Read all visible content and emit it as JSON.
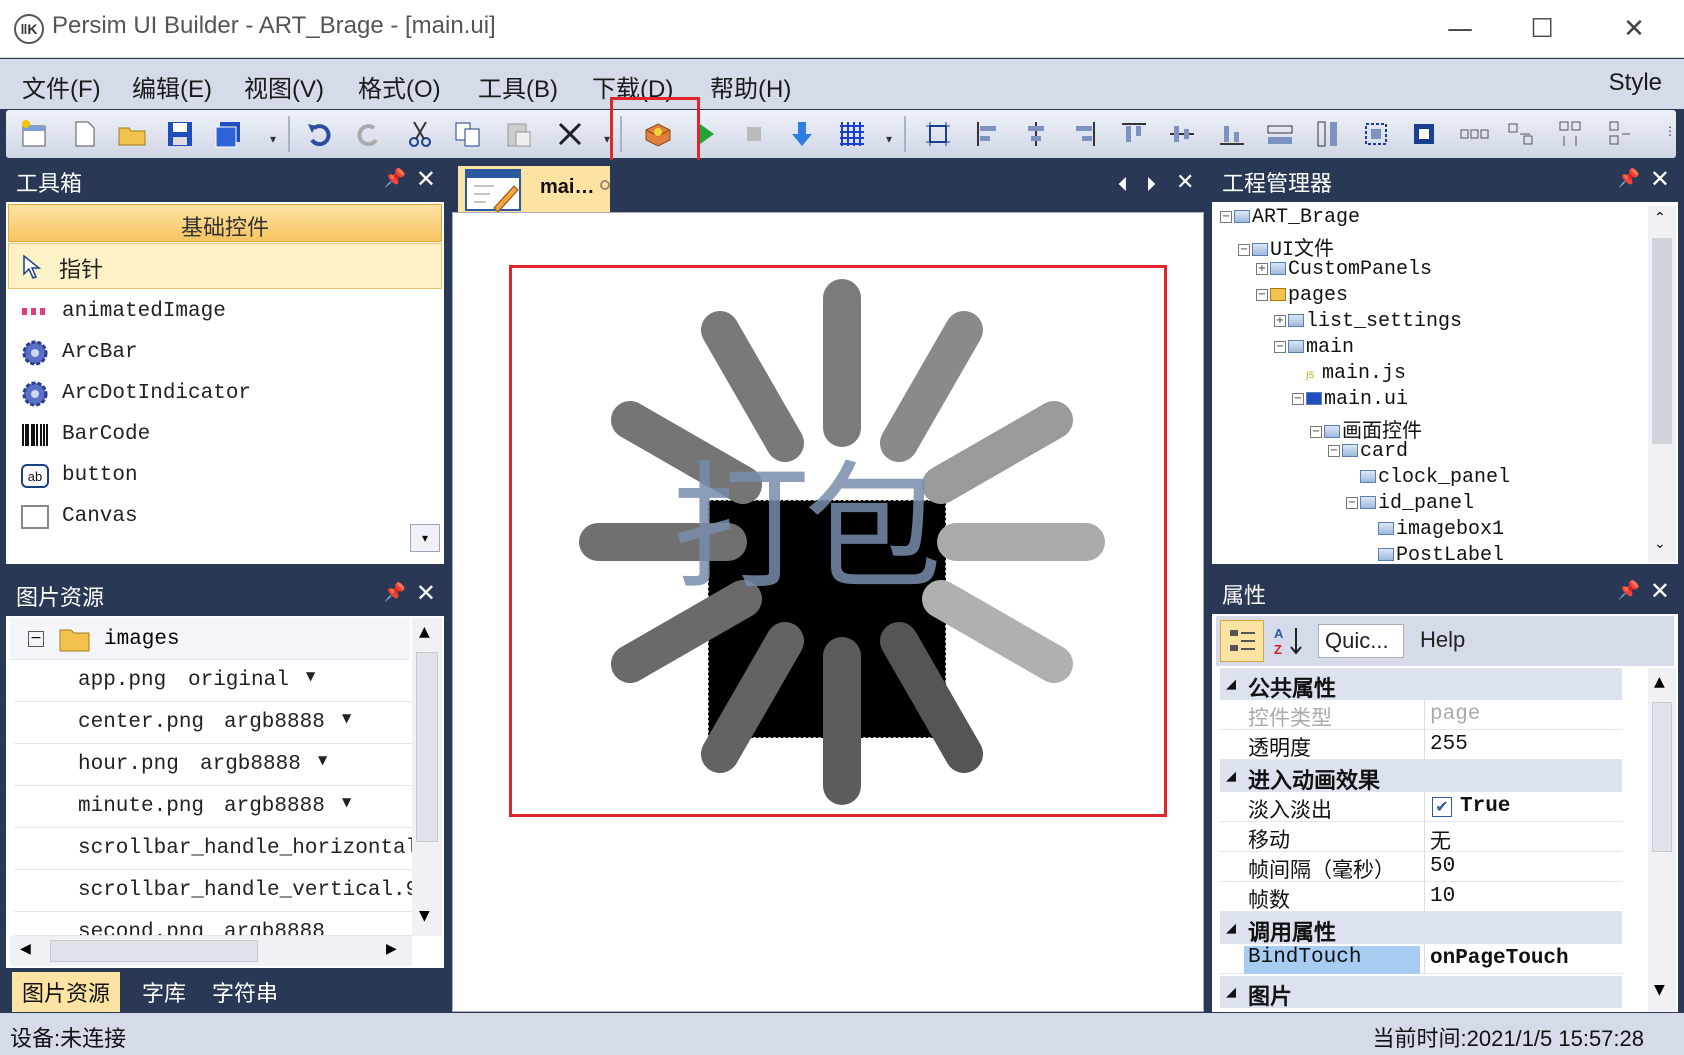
{
  "window": {
    "title": "Persim UI Builder - ART_Brage - [main.ui]",
    "logo_text": "ǁK",
    "minimize": "—",
    "maximize": "☐",
    "close": "✕"
  },
  "menu": {
    "items": [
      "文件(F)",
      "编辑(E)",
      "视图(V)",
      "格式(O)",
      "工具(B)",
      "下载(D)",
      "帮助(H)"
    ],
    "style_label": "Style"
  },
  "toolbox": {
    "title": "工具箱",
    "category": "基础控件",
    "pointer_label": "指针",
    "items": [
      "animatedImage",
      "ArcBar",
      "ArcDotIndicator",
      "BarCode",
      "button",
      "Canvas"
    ],
    "button_icon_text": "ab"
  },
  "images_panel": {
    "title": "图片资源",
    "folder": "images",
    "rows": [
      {
        "name": "app.png",
        "format": "original"
      },
      {
        "name": "center.png",
        "format": "argb8888"
      },
      {
        "name": "hour.png",
        "format": "argb8888"
      },
      {
        "name": "minute.png",
        "format": "argb8888"
      },
      {
        "name": "scrollbar_handle_horizontal.",
        "format": ""
      },
      {
        "name": "scrollbar_handle_vertical.9.",
        "format": ""
      },
      {
        "name": "second.png",
        "format": "argb8888"
      }
    ],
    "tabs": [
      "图片资源",
      "字库",
      "字符串"
    ]
  },
  "editor": {
    "tab_label": "mai…",
    "canvas_text": "打包"
  },
  "project": {
    "title": "工程管理器",
    "tree": [
      {
        "label": "ART_Brage",
        "level": 0,
        "exp": "-"
      },
      {
        "label": "UI文件",
        "level": 1,
        "exp": "-"
      },
      {
        "label": "CustomPanels",
        "level": 2,
        "exp": "+"
      },
      {
        "label": "pages",
        "level": 2,
        "exp": "-"
      },
      {
        "label": "list_settings",
        "level": 3,
        "exp": "+"
      },
      {
        "label": "main",
        "level": 3,
        "exp": "-"
      },
      {
        "label": "main.js",
        "level": 4,
        "exp": ""
      },
      {
        "label": "main.ui",
        "level": 4,
        "exp": "-"
      },
      {
        "label": "画面控件",
        "level": 5,
        "exp": "-"
      },
      {
        "label": "card",
        "level": 6,
        "exp": "-"
      },
      {
        "label": "clock_panel",
        "level": 7,
        "exp": ""
      },
      {
        "label": "id_panel",
        "level": 7,
        "exp": "-"
      },
      {
        "label": "imagebox1",
        "level": 8,
        "exp": ""
      },
      {
        "label": "PostLabel",
        "level": 8,
        "exp": ""
      }
    ]
  },
  "properties": {
    "title": "属性",
    "quick_label": "Quic...",
    "help_label": "Help",
    "categories": [
      {
        "name": "公共属性",
        "rows": [
          {
            "key": "控件类型",
            "value": "page",
            "disabled": true
          },
          {
            "key": "透明度",
            "value": "255"
          }
        ]
      },
      {
        "name": "进入动画效果",
        "rows": [
          {
            "key": "淡入淡出",
            "value": "True",
            "checkbox": true
          },
          {
            "key": "移动",
            "value": "无"
          },
          {
            "key": "帧间隔（毫秒）",
            "value": "50"
          },
          {
            "key": "帧数",
            "value": "10"
          }
        ]
      },
      {
        "name": "调用属性",
        "rows": [
          {
            "key": "BindTouch",
            "value": "onPageTouch",
            "selected": true
          }
        ]
      },
      {
        "name": "图片",
        "rows": []
      }
    ]
  },
  "status": {
    "device": "设备:未连接",
    "time": "当前时间:2021/1/5 15:57:28"
  }
}
